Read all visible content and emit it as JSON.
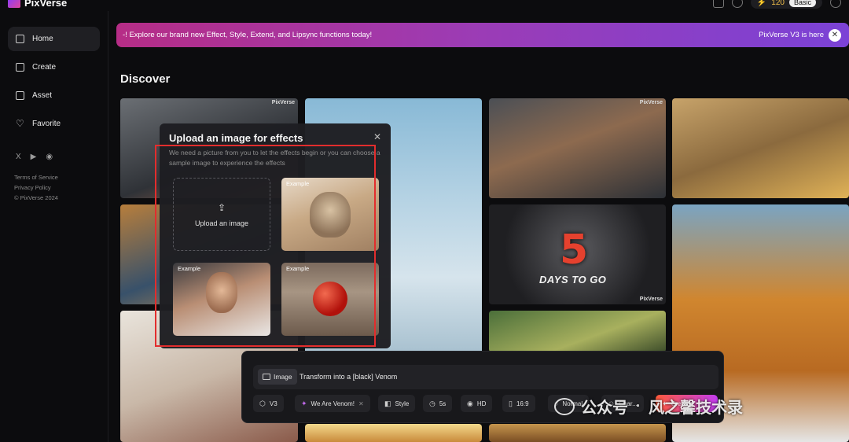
{
  "app": {
    "name": "PixVerse",
    "credits": "120",
    "plan": "Basic"
  },
  "sidebar": {
    "items": [
      {
        "label": "Home",
        "active": true
      },
      {
        "label": "Create"
      },
      {
        "label": "Asset"
      },
      {
        "label": "Favorite"
      }
    ],
    "socials": [
      "X",
      "▶",
      "◉"
    ],
    "legal": [
      "Terms of Service",
      "Privacy Policy",
      "© PixVerse 2024"
    ]
  },
  "banner": {
    "message": "-! Explore our brand new Effect, Style, Extend, and Lipsync functions today!",
    "right": "PixVerse V3 is here",
    "close": "✕"
  },
  "page": {
    "title": "Discover"
  },
  "gallery": {
    "watermark": "PixVerse",
    "countdown_number": "5",
    "countdown_text": "DAYS TO GO"
  },
  "upload_panel": {
    "title": "Upload an image for effects",
    "close": "✕",
    "description": "We need a picture from you to let the effects begin or you can choose a sample image to experience the effects",
    "upload_label": "Upload an image",
    "example_label": "Example"
  },
  "prompt": {
    "image_tag": "Image",
    "text": "Transform into a [black] Venom"
  },
  "options": {
    "model": "V3",
    "effect": "We Are Venom!",
    "style": "Style",
    "duration": "5s",
    "quality": "HD",
    "ratio": "16:9",
    "motion": "Normal",
    "character": "Char...",
    "create": "Create",
    "cost": "30"
  },
  "overlay_watermark": {
    "left": "公众号",
    "right": "风之馨技术录"
  },
  "colors": {
    "accent_pink": "#b62d86",
    "accent_purple": "#7b42d6",
    "highlight_red": "#e22d2d",
    "create_gradient_start": "#ff5a3a"
  }
}
